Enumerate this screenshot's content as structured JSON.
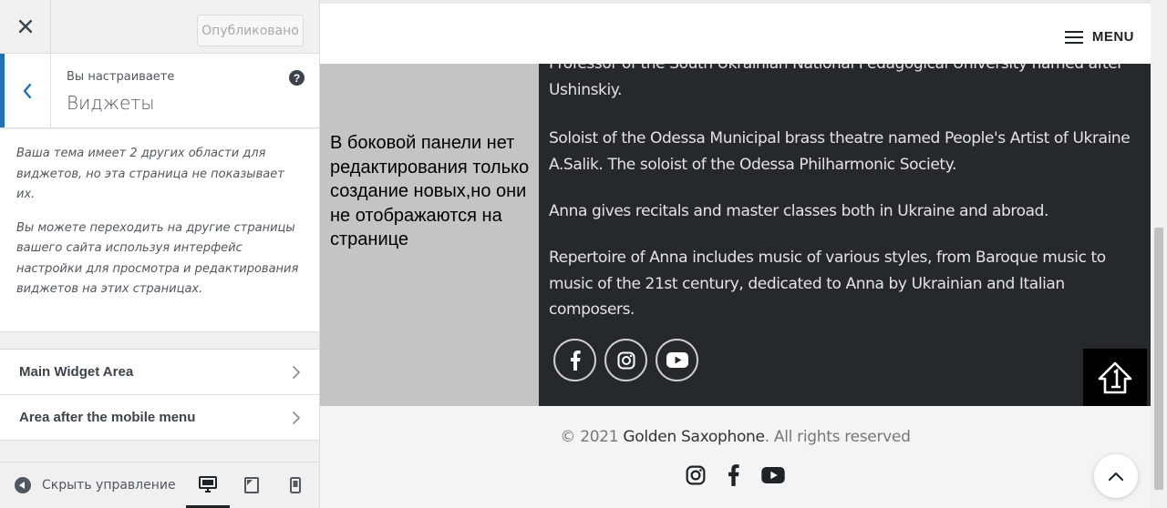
{
  "sidebar": {
    "publish_label": "Опубликовано",
    "crumb": "Вы настраиваете",
    "section_title": "Виджеты",
    "help_glyph": "?",
    "description": [
      "Ваша тема имеет 2 других области для виджетов, но эта страница не показывает их.",
      "Вы можете переходить на другие страницы вашего сайта используя интерфейс настройки для просмотра и редактирования виджетов на этих страницах."
    ],
    "widget_areas": [
      {
        "label": "Main Widget Area"
      },
      {
        "label": "Area after the mobile menu"
      }
    ],
    "collapse_label": "Скрыть управление",
    "active_device": "desktop"
  },
  "preview": {
    "menu_label": "MENU",
    "gray_note": "В боковой панели нет редактирования только создание новых,но они не отображаются на странице",
    "bio_partial": "Professor of the South Ukrainian National Pedagogical University named after Ushinskiy.",
    "bio_paragraphs": [
      "Soloist of the Odessa Municipal brass theatre named People's Artist of Ukraine A.Salik. The soloist of the Odessa Philharmonic Society.",
      "Anna gives recitals and master classes both in Ukraine and abroad.",
      "Repertoire of Anna includes music of various styles, from Baroque music to music of the 21st century, dedicated to Anna by Ukrainian and Italian composers."
    ],
    "social_icons": [
      "facebook-icon",
      "instagram-icon",
      "youtube-icon"
    ],
    "footer": {
      "copyright_prefix": "© 2021",
      "brand": "Golden Saxophone",
      "copyright_suffix": ". All rights reserved",
      "icons": [
        "instagram-icon",
        "facebook-icon",
        "youtube-icon"
      ]
    }
  },
  "colors": {
    "accent": "#2271b1",
    "dark_section": "#25292c",
    "gray_section": "#c4c4c4"
  }
}
